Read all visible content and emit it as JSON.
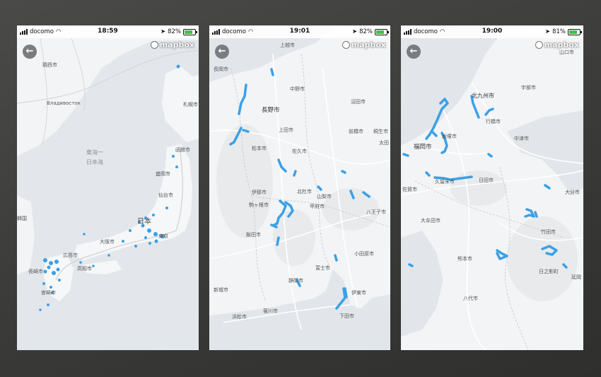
{
  "screens": [
    {
      "status": {
        "carrier": "docomo",
        "time": "18:59",
        "battery": "82%",
        "battery_level": 0.82
      },
      "labels": [
        "鶏西市",
        "Владивосток",
        "札幌市",
        "東海一",
        "日本海",
        "函館市",
        "盛岡市",
        "仙台市",
        "日本",
        "広島市",
        "大阪市",
        "高知市",
        "長崎市",
        "宮崎市",
        "東京",
        "韓国"
      ]
    },
    {
      "status": {
        "carrier": "docomo",
        "time": "19:01",
        "battery": "82%",
        "battery_level": 0.82
      },
      "labels": [
        "上越市",
        "長岡市",
        "中野市",
        "長野市",
        "沼田市",
        "上田市",
        "前橋市",
        "桐生市",
        "太田",
        "松本市",
        "佐久市",
        "伊那市",
        "駒ヶ根市",
        "北杜市",
        "山梨市",
        "甲府市",
        "八王子市",
        "飯田市",
        "富士市",
        "小田原市",
        "静岡市",
        "伊東市",
        "浜松市",
        "菊川市",
        "下田市",
        "新城市"
      ]
    },
    {
      "status": {
        "carrier": "docomo",
        "time": "19:00",
        "battery": "81%",
        "battery_level": 0.81
      },
      "labels": [
        "山口市",
        "宇部市",
        "北九州市",
        "行橋市",
        "福岡市",
        "飯塚市",
        "中津市",
        "久留米市",
        "日田市",
        "佐賀市",
        "大分市",
        "大牟田市",
        "竹田市",
        "熊本市",
        "八代市",
        "延岡",
        "日之影町"
      ]
    }
  ],
  "brand": "mapbox",
  "colors": {
    "route": "#3aa0e8",
    "land": "#f4f5f6",
    "water": "#e2e6ea",
    "road": "#ffffff"
  }
}
